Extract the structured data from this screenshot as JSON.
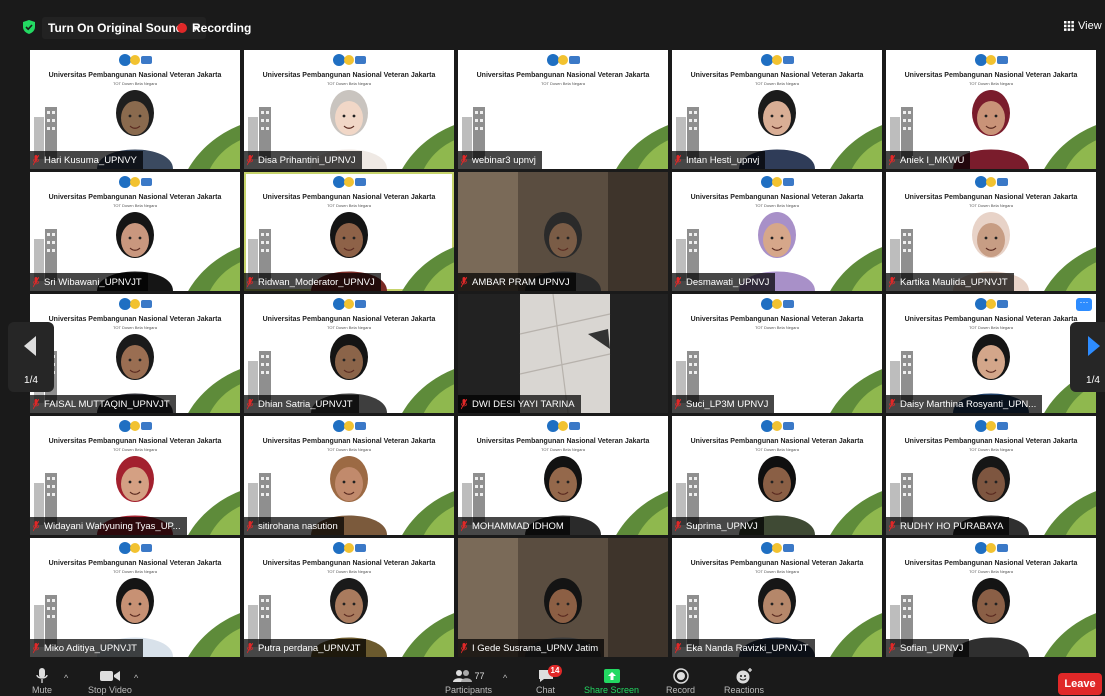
{
  "topbar": {
    "sound_label": "Turn On Original Sound",
    "recording_label": "Recording",
    "view_label": "View"
  },
  "slide": {
    "title": "Universitas Pembangunan Nasional Veteran Jakarta",
    "subtitle": "TOT Dosen Bela Negara"
  },
  "gallery": {
    "page_indicator": "1/4",
    "participants": [
      {
        "name": "Hari Kusuma_UPNVY",
        "style": "slide",
        "skin": "#8a6a4e",
        "hair": "#1e1e1e",
        "shirt": "#3b4a60"
      },
      {
        "name": "Disa Prihantini_UPNVJ",
        "style": "slide",
        "skin": "#f1d7c7",
        "hair": "#c9c4bf",
        "shirt": "#efe9e4"
      },
      {
        "name": "webinar3 upnvj",
        "style": "slide"
      },
      {
        "name": "Intan Hesti_upnvj",
        "style": "slide",
        "skin": "#d9ae95",
        "hair": "#1b1b1b",
        "shirt": "#2f3c58"
      },
      {
        "name": "Aniek I_MKWU",
        "style": "slide",
        "skin": "#c99378",
        "hair": "#7a1c2c",
        "shirt": "#7a1c2c"
      },
      {
        "name": "Sri Wibawani_UPNVJT",
        "style": "slide",
        "skin": "#c9977e",
        "hair": "#151515",
        "shirt": "#151515"
      },
      {
        "name": "Ridwan_Moderator_UPNVJ",
        "style": "slide",
        "skin": "#8e6248",
        "hair": "#141414",
        "shirt": "#7a2a24",
        "highlight": true
      },
      {
        "name": "AMBAR PRAM UPNVJ",
        "style": "dark",
        "skin": "#7a5c46",
        "hair": "#2a2a2a",
        "shirt": "#2a2a2a"
      },
      {
        "name": "Desmawati_UPNVJ",
        "style": "slide",
        "skin": "#d6a78a",
        "hair": "#a890c8",
        "shirt": "#a890c8"
      },
      {
        "name": "Kartika Maulida_UPNVJT",
        "style": "slide",
        "skin": "#c79d84",
        "hair": "#e8d3c8",
        "shirt": "#e8d3c8"
      },
      {
        "name": "FAISAL MUTTAQIN_UPNVJT",
        "style": "slide",
        "skin": "#9a6e52",
        "hair": "#1a1a1a",
        "shirt": "#2c2c34"
      },
      {
        "name": "Dhian Satria_UPNVJT",
        "style": "slide",
        "skin": "#8b6449",
        "hair": "#141414",
        "shirt": "#3e3e3e"
      },
      {
        "name": "DWI DESI YAYI TARINA",
        "style": "dark"
      },
      {
        "name": "Suci_LP3M UPNVJ",
        "style": "slide"
      },
      {
        "name": "Daisy Marthina Rosyanti_UPN...",
        "style": "slide",
        "skin": "#d3a68a",
        "hair": "#151515",
        "shirt": "#1d3d66",
        "more": true
      },
      {
        "name": "Widayani Wahyuning Tyas_UP...",
        "style": "slide",
        "skin": "#d4a083",
        "hair": "#a3202e",
        "shirt": "#a3202e"
      },
      {
        "name": "sitirohana nasution",
        "style": "slide",
        "skin": "#c18a6c",
        "hair": "#9c6a44",
        "shirt": "#7b5a3c"
      },
      {
        "name": "MOHAMMAD IDHOM",
        "style": "slide",
        "skin": "#94684b",
        "hair": "#121212",
        "shirt": "#2a2a2a"
      },
      {
        "name": "Suprima_UPNVJ",
        "style": "slide",
        "skin": "#8a5f45",
        "hair": "#0f0f0f",
        "shirt": "#3f4a34"
      },
      {
        "name": "RUDHY HO PURABAYA",
        "style": "slide",
        "skin": "#7e5640",
        "hair": "#161616",
        "shirt": "#2f2f2f"
      },
      {
        "name": "Miko Aditiya_UPNVJT",
        "style": "slide",
        "skin": "#c79174",
        "hair": "#151515",
        "shirt": "#d8e1ea"
      },
      {
        "name": "Putra perdana_UPNVJT",
        "style": "slide",
        "skin": "#a97b5e",
        "hair": "#1a1a1a",
        "shirt": "#6b5a2e"
      },
      {
        "name": "I Gede Susrama_UPNV Jatim",
        "style": "dark",
        "skin": "#8c5f44",
        "hair": "#141414",
        "shirt": "#3b3b3b"
      },
      {
        "name": "Eka Nanda Ravizki_UPNVJT",
        "style": "slide",
        "skin": "#b5876a",
        "hair": "#161616",
        "shirt": "#2b3a52"
      },
      {
        "name": "Sofian_UPNVJ",
        "style": "slide",
        "skin": "#8a5f46",
        "hair": "#141414",
        "shirt": "#2f2f2f"
      }
    ]
  },
  "toolbar": {
    "mute_label": "Mute",
    "stop_video_label": "Stop Video",
    "participants_label": "Participants",
    "participants_count": "77",
    "chat_label": "Chat",
    "chat_badge": "14",
    "share_label": "Share Screen",
    "record_label": "Record",
    "reactions_label": "Reactions",
    "leave_label": "Leave"
  },
  "colors": {
    "accent_blue": "#2d8cff",
    "share_green": "#23d962",
    "leave_red": "#e02828",
    "active_speaker": "#c6d36b"
  }
}
